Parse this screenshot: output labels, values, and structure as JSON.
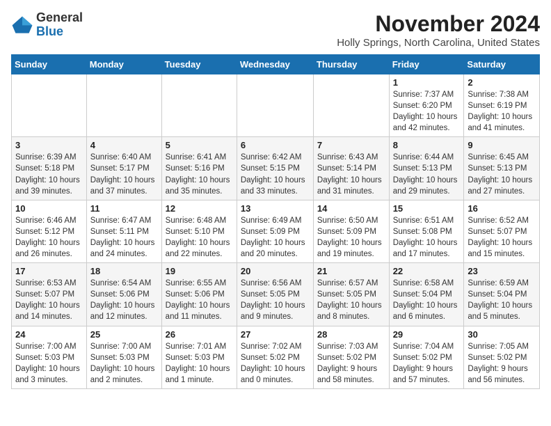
{
  "logo": {
    "general": "General",
    "blue": "Blue"
  },
  "title": "November 2024",
  "location": "Holly Springs, North Carolina, United States",
  "days_header": [
    "Sunday",
    "Monday",
    "Tuesday",
    "Wednesday",
    "Thursday",
    "Friday",
    "Saturday"
  ],
  "weeks": [
    [
      {
        "day": "",
        "detail": ""
      },
      {
        "day": "",
        "detail": ""
      },
      {
        "day": "",
        "detail": ""
      },
      {
        "day": "",
        "detail": ""
      },
      {
        "day": "",
        "detail": ""
      },
      {
        "day": "1",
        "detail": "Sunrise: 7:37 AM\nSunset: 6:20 PM\nDaylight: 10 hours\nand 42 minutes."
      },
      {
        "day": "2",
        "detail": "Sunrise: 7:38 AM\nSunset: 6:19 PM\nDaylight: 10 hours\nand 41 minutes."
      }
    ],
    [
      {
        "day": "3",
        "detail": "Sunrise: 6:39 AM\nSunset: 5:18 PM\nDaylight: 10 hours\nand 39 minutes."
      },
      {
        "day": "4",
        "detail": "Sunrise: 6:40 AM\nSunset: 5:17 PM\nDaylight: 10 hours\nand 37 minutes."
      },
      {
        "day": "5",
        "detail": "Sunrise: 6:41 AM\nSunset: 5:16 PM\nDaylight: 10 hours\nand 35 minutes."
      },
      {
        "day": "6",
        "detail": "Sunrise: 6:42 AM\nSunset: 5:15 PM\nDaylight: 10 hours\nand 33 minutes."
      },
      {
        "day": "7",
        "detail": "Sunrise: 6:43 AM\nSunset: 5:14 PM\nDaylight: 10 hours\nand 31 minutes."
      },
      {
        "day": "8",
        "detail": "Sunrise: 6:44 AM\nSunset: 5:13 PM\nDaylight: 10 hours\nand 29 minutes."
      },
      {
        "day": "9",
        "detail": "Sunrise: 6:45 AM\nSunset: 5:13 PM\nDaylight: 10 hours\nand 27 minutes."
      }
    ],
    [
      {
        "day": "10",
        "detail": "Sunrise: 6:46 AM\nSunset: 5:12 PM\nDaylight: 10 hours\nand 26 minutes."
      },
      {
        "day": "11",
        "detail": "Sunrise: 6:47 AM\nSunset: 5:11 PM\nDaylight: 10 hours\nand 24 minutes."
      },
      {
        "day": "12",
        "detail": "Sunrise: 6:48 AM\nSunset: 5:10 PM\nDaylight: 10 hours\nand 22 minutes."
      },
      {
        "day": "13",
        "detail": "Sunrise: 6:49 AM\nSunset: 5:09 PM\nDaylight: 10 hours\nand 20 minutes."
      },
      {
        "day": "14",
        "detail": "Sunrise: 6:50 AM\nSunset: 5:09 PM\nDaylight: 10 hours\nand 19 minutes."
      },
      {
        "day": "15",
        "detail": "Sunrise: 6:51 AM\nSunset: 5:08 PM\nDaylight: 10 hours\nand 17 minutes."
      },
      {
        "day": "16",
        "detail": "Sunrise: 6:52 AM\nSunset: 5:07 PM\nDaylight: 10 hours\nand 15 minutes."
      }
    ],
    [
      {
        "day": "17",
        "detail": "Sunrise: 6:53 AM\nSunset: 5:07 PM\nDaylight: 10 hours\nand 14 minutes."
      },
      {
        "day": "18",
        "detail": "Sunrise: 6:54 AM\nSunset: 5:06 PM\nDaylight: 10 hours\nand 12 minutes."
      },
      {
        "day": "19",
        "detail": "Sunrise: 6:55 AM\nSunset: 5:06 PM\nDaylight: 10 hours\nand 11 minutes."
      },
      {
        "day": "20",
        "detail": "Sunrise: 6:56 AM\nSunset: 5:05 PM\nDaylight: 10 hours\nand 9 minutes."
      },
      {
        "day": "21",
        "detail": "Sunrise: 6:57 AM\nSunset: 5:05 PM\nDaylight: 10 hours\nand 8 minutes."
      },
      {
        "day": "22",
        "detail": "Sunrise: 6:58 AM\nSunset: 5:04 PM\nDaylight: 10 hours\nand 6 minutes."
      },
      {
        "day": "23",
        "detail": "Sunrise: 6:59 AM\nSunset: 5:04 PM\nDaylight: 10 hours\nand 5 minutes."
      }
    ],
    [
      {
        "day": "24",
        "detail": "Sunrise: 7:00 AM\nSunset: 5:03 PM\nDaylight: 10 hours\nand 3 minutes."
      },
      {
        "day": "25",
        "detail": "Sunrise: 7:00 AM\nSunset: 5:03 PM\nDaylight: 10 hours\nand 2 minutes."
      },
      {
        "day": "26",
        "detail": "Sunrise: 7:01 AM\nSunset: 5:03 PM\nDaylight: 10 hours\nand 1 minute."
      },
      {
        "day": "27",
        "detail": "Sunrise: 7:02 AM\nSunset: 5:02 PM\nDaylight: 10 hours\nand 0 minutes."
      },
      {
        "day": "28",
        "detail": "Sunrise: 7:03 AM\nSunset: 5:02 PM\nDaylight: 9 hours\nand 58 minutes."
      },
      {
        "day": "29",
        "detail": "Sunrise: 7:04 AM\nSunset: 5:02 PM\nDaylight: 9 hours\nand 57 minutes."
      },
      {
        "day": "30",
        "detail": "Sunrise: 7:05 AM\nSunset: 5:02 PM\nDaylight: 9 hours\nand 56 minutes."
      }
    ]
  ]
}
